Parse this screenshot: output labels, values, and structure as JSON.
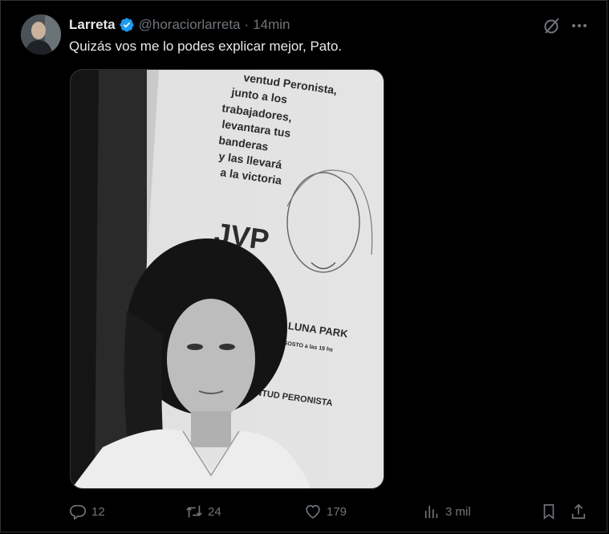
{
  "tweet": {
    "author_name": "Larreta",
    "handle": "@horaciorlarreta",
    "separator": "·",
    "time": "14min",
    "text": "Quizás vos me lo podes explicar mejor, Pato.",
    "verified": true
  },
  "media": {
    "poster_text_1": "ventud Peronista,",
    "poster_text_2": "junto a los",
    "poster_text_3": "trabajadores,",
    "poster_text_4": "levantara tus",
    "poster_text_5": "banderas",
    "poster_text_6": "y las llevará",
    "poster_text_7": "a la victoria",
    "poster_logo": "JVP",
    "poster_venue": "AL LUNA PARK",
    "poster_date": "de AGOSTO a las 19 hs",
    "poster_footer": "NTUD PERONISTA"
  },
  "actions": {
    "replies": "12",
    "retweets": "24",
    "likes": "179",
    "views": "3 mil"
  },
  "colors": {
    "background": "#000000",
    "text": "#e7e9ea",
    "secondary": "#71767b",
    "verified": "#1d9bf0",
    "border": "#2f3336"
  },
  "icons": {
    "verified": "verified-badge-icon",
    "grok": "grok-icon",
    "more": "more-icon",
    "reply": "reply-icon",
    "retweet": "retweet-icon",
    "like": "heart-icon",
    "views": "views-icon",
    "bookmark": "bookmark-icon",
    "share": "share-icon"
  }
}
